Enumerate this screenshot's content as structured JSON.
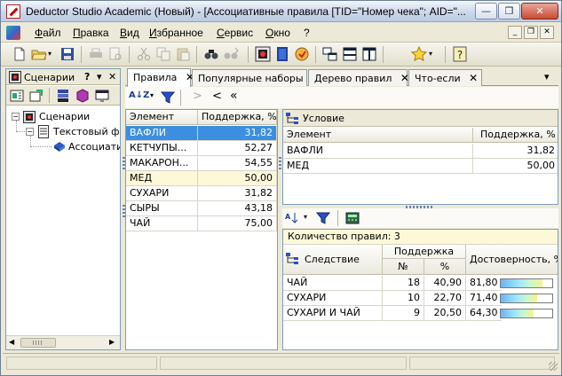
{
  "window": {
    "title": "Deductor Studio Academic (Новый) - [Ассоциативные правила [TID=\"Номер чека\"; AID=\"...",
    "minimize_glyph": "—",
    "restore_glyph": "❐",
    "close_glyph": "✕"
  },
  "menu": {
    "items": [
      "Файл",
      "Правка",
      "Вид",
      "Избранное",
      "Сервис",
      "Окно",
      "?"
    ],
    "mdi_buttons": [
      "_",
      "❐",
      "✕"
    ]
  },
  "toolbar": {
    "icons": [
      "new-icon",
      "open-icon",
      "save-icon",
      "print-icon",
      "preview-icon",
      "cut-icon",
      "copy-icon",
      "paste-icon",
      "find-icon",
      "find-next-icon",
      "scenario-icon",
      "notebook-icon",
      "run-icon",
      "layout-icon",
      "layout-h-icon",
      "layout-v-icon",
      "star-icon",
      "help-icon"
    ]
  },
  "left_panel": {
    "title": "Сценарии",
    "help": "?",
    "dropdown": "▾",
    "close": "✕",
    "tree": [
      {
        "label": "Сценарии",
        "level": 0,
        "expander": "−"
      },
      {
        "label": "Текстовый фа",
        "level": 1,
        "expander": "−"
      },
      {
        "label": "Ассоциатие",
        "level": 2,
        "expander": ""
      }
    ],
    "scroll_left": "◀",
    "scroll_right": "▶"
  },
  "tabs": {
    "items": [
      {
        "label": "Правила",
        "close": "✕",
        "active": true
      },
      {
        "label": "Популярные наборы",
        "close": "✕",
        "active": false
      },
      {
        "label": "Дерево правил",
        "close": "✕",
        "active": false
      },
      {
        "label": "Что-если",
        "close": "✕",
        "active": false
      }
    ],
    "overflow": "▾"
  },
  "nav_toolbar": {
    "sort_label": "A↓Z",
    "sort_dropdown": "▾",
    "next": ">",
    "prev": "<",
    "first": "«"
  },
  "items_table": {
    "headers": [
      "Элемент",
      "Поддержка, %"
    ],
    "rows": [
      {
        "element": "ВАФЛИ",
        "support": "31,82",
        "state": "selected"
      },
      {
        "element": "КЕТЧУПЫ...",
        "support": "52,27",
        "state": ""
      },
      {
        "element": "МАКАРОН...",
        "support": "54,55",
        "state": ""
      },
      {
        "element": "МЕД",
        "support": "50,00",
        "state": "checked"
      },
      {
        "element": "СУХАРИ",
        "support": "31,82",
        "state": ""
      },
      {
        "element": "СЫРЫ",
        "support": "43,18",
        "state": ""
      },
      {
        "element": "ЧАЙ",
        "support": "75,00",
        "state": ""
      }
    ]
  },
  "condition_table": {
    "title": "Условие",
    "headers": [
      "Элемент",
      "Поддержка, %"
    ],
    "rows": [
      {
        "element": "ВАФЛИ",
        "support": "31,82"
      },
      {
        "element": "МЕД",
        "support": "50,00"
      }
    ]
  },
  "result_toolbar": {
    "rule_count_label": "Количество правил: 3"
  },
  "consequent_table": {
    "title": "Следствие",
    "support_group": "Поддержка",
    "sub_headers": [
      "№",
      "%"
    ],
    "confidence_header": "Достоверность, %",
    "bar_colors": [
      "#6db3f2",
      "#9be3ff",
      "#c7f7d5",
      "#f7f38a"
    ],
    "rows": [
      {
        "consequent": "ЧАЙ",
        "n": "18",
        "pct": "40,90",
        "confidence": "81,80",
        "confidence_value": 81.8
      },
      {
        "consequent": "СУХАРИ",
        "n": "10",
        "pct": "22,70",
        "confidence": "71,40",
        "confidence_value": 71.4
      },
      {
        "consequent": "СУХАРИ И ЧАЙ",
        "n": "9",
        "pct": "20,50",
        "confidence": "64,30",
        "confidence_value": 64.3
      }
    ]
  }
}
